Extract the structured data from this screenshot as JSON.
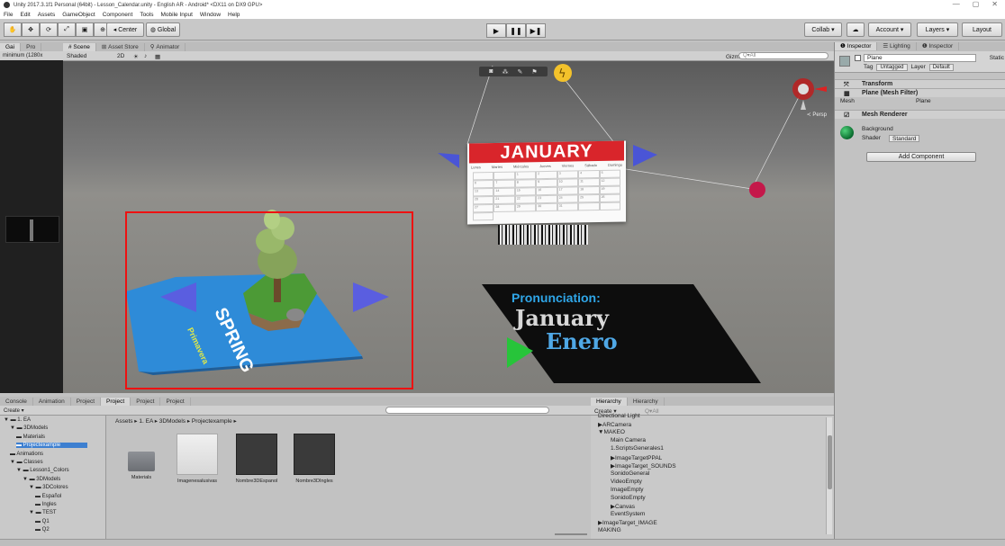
{
  "window": {
    "title": "Unity 2017.3.1f1 Personal (64bit) - Lesson_Calendar.unity - English AR - Android* <DX11 on DX9 GPU>",
    "controls": [
      "—",
      "▢",
      "✕"
    ]
  },
  "menu": [
    "File",
    "Edit",
    "Assets",
    "GameObject",
    "Component",
    "Tools",
    "Mobile Input",
    "Window",
    "Help"
  ],
  "toolbar": {
    "pivot": "Center",
    "space": "Global",
    "play": "▶",
    "pause": "❚❚",
    "step": "▶❚",
    "collab": "Collab ▾",
    "account": "Account ▾",
    "layers": "Layers ▾",
    "layout": "Layout"
  },
  "game": {
    "tabs": [
      "Gai",
      "Pro"
    ],
    "resolution": "minimum (1280x"
  },
  "scene": {
    "tabs": [
      "Scene",
      "Asset Store",
      "Animator"
    ],
    "shading": "Shaded",
    "mode_2d": "2D",
    "gizmos": "Gizmos ▾",
    "search": "Q▾All",
    "persp": "≺ Persp"
  },
  "calendar": {
    "month": "JANUARY",
    "days": [
      "Lunes",
      "Martes",
      "Miércoles",
      "Jueves",
      "Viernes",
      "Sábado",
      "Domingo"
    ],
    "dates": [
      "",
      "",
      "1",
      "2",
      "3",
      "4",
      "5",
      "6",
      "7",
      "8",
      "9",
      "10",
      "11",
      "12",
      "13",
      "14",
      "15",
      "16",
      "17",
      "18",
      "19",
      "20",
      "21",
      "22",
      "23",
      "24",
      "25",
      "26",
      "27",
      "28",
      "29",
      "30",
      "31",
      "",
      "",
      ""
    ]
  },
  "spring_board": {
    "title": "SPRING",
    "subtitle": "Primavera"
  },
  "pron_board": {
    "title": "Pronunciation:",
    "english": "January",
    "spanish": "Enero"
  },
  "inspector": {
    "tabs": [
      "Inspector",
      "Lighting",
      "Inspector"
    ],
    "object_name": "Plane",
    "static_label": "Static",
    "tag_label": "Tag",
    "tag_value": "Untagged",
    "layer_label": "Layer",
    "layer_value": "Default",
    "components": {
      "transform": "Transform",
      "mesh_filter": "Plane (Mesh Filter)",
      "mesh_label": "Mesh",
      "mesh_value": "Plane",
      "mesh_renderer": "Mesh Renderer",
      "material_name": "Background",
      "shader_label": "Shader",
      "shader_value": "Standard"
    },
    "add_component": "Add Component"
  },
  "project": {
    "tabs": [
      "Console",
      "Animation",
      "Project",
      "Project",
      "Project",
      "Project"
    ],
    "create": "Create ▾",
    "tree": [
      {
        "label": "1. EA",
        "level": 0,
        "expanded": true
      },
      {
        "label": "3DModels",
        "level": 1,
        "expanded": true
      },
      {
        "label": "Materials",
        "level": 2
      },
      {
        "label": "Projectexample",
        "level": 2,
        "selected": true
      },
      {
        "label": "Animations",
        "level": 1
      },
      {
        "label": "Classes",
        "level": 1,
        "expanded": true
      },
      {
        "label": "Lesson1_Colors",
        "level": 2,
        "expanded": true
      },
      {
        "label": "3DModels",
        "level": 3,
        "expanded": true
      },
      {
        "label": "3DColores",
        "level": 4,
        "expanded": true
      },
      {
        "label": "Español",
        "level": 5
      },
      {
        "label": "Ingles",
        "level": 5
      },
      {
        "label": "TEST",
        "level": 4,
        "expanded": true
      },
      {
        "label": "Q1",
        "level": 5
      },
      {
        "label": "Q2",
        "level": 5
      }
    ],
    "breadcrumb": "Assets ▸ 1. EA ▸ 3DModels ▸ Projectexample ▸",
    "assets": [
      "Materials",
      "Imagenesalusivas",
      "Nombre3DEspanol",
      "Nombre3DIngles"
    ]
  },
  "hierarchy": {
    "tabs": [
      "Hierarchy",
      "Hierarchy"
    ],
    "create": "Create ▾",
    "search": "Q▾All",
    "items": [
      {
        "label": "Directional Light",
        "level": 0
      },
      {
        "label": "ARCamera",
        "level": 0,
        "arrow": "▶"
      },
      {
        "label": "MAKEO",
        "level": 0,
        "arrow": "▼"
      },
      {
        "label": "Main Camera",
        "level": 1
      },
      {
        "label": "1.ScriptsGenerales1",
        "level": 1
      },
      {
        "label": "ImageTargetPPAL",
        "level": 1,
        "arrow": "▶"
      },
      {
        "label": "ImageTarget_SOUNDS",
        "level": 1,
        "arrow": "▶"
      },
      {
        "label": "SonidoGeneral",
        "level": 1
      },
      {
        "label": "VideoEmpty",
        "level": 1
      },
      {
        "label": "ImageEmpty",
        "level": 1
      },
      {
        "label": "SonidoEmpty",
        "level": 1
      },
      {
        "label": "Canvas",
        "level": 1,
        "arrow": "▶"
      },
      {
        "label": "EventSystem",
        "level": 1
      },
      {
        "label": "ImageTarget_IMAGE",
        "level": 0,
        "arrow": "▶"
      },
      {
        "label": "MAKING",
        "level": 0
      }
    ]
  }
}
